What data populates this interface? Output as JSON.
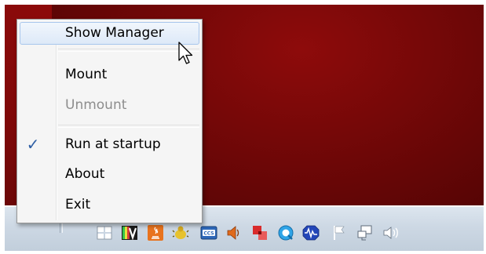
{
  "menu": {
    "items": [
      {
        "label": "Show Manager",
        "state": "hover"
      },
      {
        "label": "Mount",
        "state": "normal"
      },
      {
        "label": "Unmount",
        "state": "disabled"
      },
      {
        "label": "Run at startup",
        "state": "checked"
      },
      {
        "label": "About",
        "state": "normal"
      },
      {
        "label": "Exit",
        "state": "normal"
      }
    ],
    "check_glyph": "✓"
  },
  "tray": {
    "icons": [
      "windows-flag-icon",
      "app-vm-icon",
      "java-icon",
      "bug-icon",
      "ccs-icon",
      "speaker-icon",
      "paint-icon",
      "quicktime-icon",
      "waveform-icon",
      "action-center-flag-icon",
      "network-icon",
      "volume-icon"
    ],
    "ccs_text": "CCS",
    "accent_color": "#3b6db8"
  },
  "colors": {
    "wallpaper": "#6e0707",
    "menu_bg": "#f5f5f5",
    "highlight_border": "#a8c6ec"
  }
}
